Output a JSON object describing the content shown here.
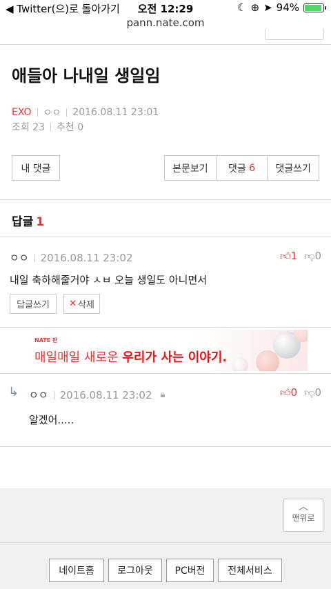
{
  "status": {
    "back_label": "◀ Twitter(으)로 돌아가기",
    "time": "오전 12:29",
    "battery": "94%",
    "battery_level": 0.94,
    "icons": [
      "moon-icon",
      "lock-rotation-icon",
      "location-arrow-icon",
      "battery-icon"
    ]
  },
  "url": "pann.nate.com",
  "post": {
    "title": "애들아 나내일 생일임",
    "category": "EXO",
    "author": "ㅇㅇ",
    "date": "2016.08.11 23:01",
    "views": "조회 23",
    "recommend": "추천 0"
  },
  "buttons": {
    "my_comments": "내 댓글",
    "view_body": "본문보기",
    "comments_label": "댓글",
    "comments_count": "6",
    "write_comment": "댓글쓰기"
  },
  "replies": {
    "label": "답글",
    "count": "1"
  },
  "comment1": {
    "author": "ㅇㅇ",
    "date": "2016.08.11 23:02",
    "text": "내일 축하해줄거야 ㅅㅂ 오늘 생일도 아니면서",
    "up": "1",
    "down": "0",
    "reply_btn": "답글쓰기",
    "delete_btn": "삭제"
  },
  "ad": {
    "brand": "NATE 판",
    "text_plain": "매일매일 새로운 ",
    "text_bold": "우리가 사는 이야기."
  },
  "comment2": {
    "author": "ㅇㅇ",
    "date": "2016.08.11 23:02",
    "text": "알겠어.....",
    "up": "0",
    "down": "0"
  },
  "top_button": "맨위로",
  "footer": {
    "home": "네이트홈",
    "logout": "로그아웃",
    "pc": "PC버전",
    "all_services": "전체서비스"
  }
}
